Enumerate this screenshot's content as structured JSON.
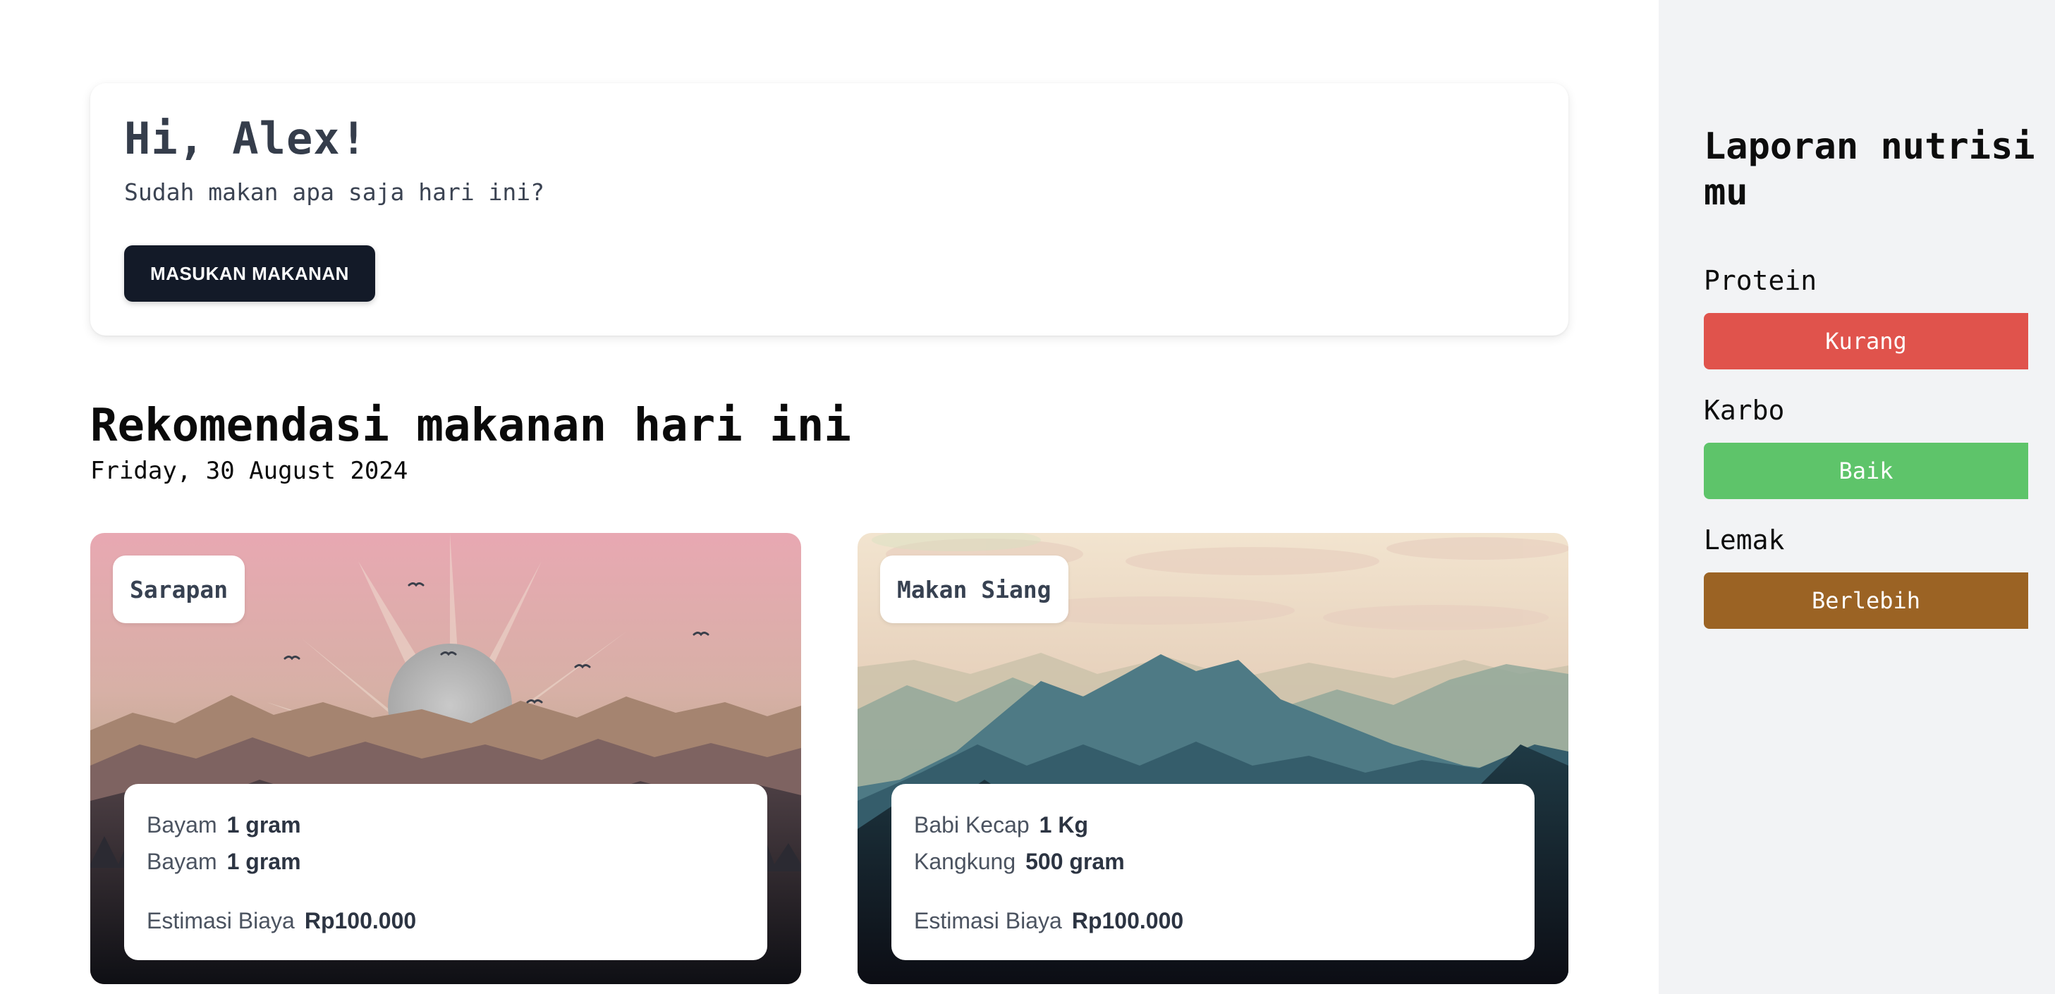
{
  "greeting": {
    "title": "Hi, Alex!",
    "subtitle": "Sudah makan apa saja hari ini?",
    "button_label": "MASUKAN MAKANAN"
  },
  "recommendations": {
    "title": "Rekomendasi makanan hari ini",
    "date": "Friday, 30 August 2024",
    "meals": [
      {
        "label": "Sarapan",
        "items": [
          {
            "name": "Bayam",
            "amount": "1 gram"
          },
          {
            "name": "Bayam",
            "amount": "1 gram"
          }
        ],
        "cost_label": "Estimasi Biaya",
        "cost_value": "Rp100.000"
      },
      {
        "label": "Makan Siang",
        "items": [
          {
            "name": "Babi Kecap",
            "amount": "1 Kg"
          },
          {
            "name": "Kangkung",
            "amount": "500 gram"
          }
        ],
        "cost_label": "Estimasi Biaya",
        "cost_value": "Rp100.000"
      }
    ]
  },
  "nutrition_report": {
    "title": "Laporan nutrisi mu",
    "items": [
      {
        "name": "Protein",
        "status": "Kurang",
        "color": "#e0534c"
      },
      {
        "name": "Karbo",
        "status": "Baik",
        "color": "#5ec46a"
      },
      {
        "name": "Lemak",
        "status": "Berlebih",
        "color": "#9b6324"
      }
    ]
  }
}
